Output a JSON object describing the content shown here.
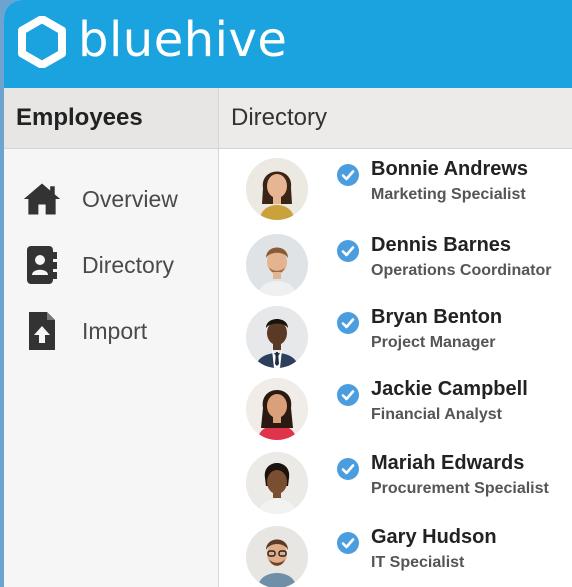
{
  "app": {
    "brand": "bluehive",
    "accent_color": "#1aa3df"
  },
  "sidebar": {
    "title": "Employees",
    "items": [
      {
        "label": "Overview",
        "icon": "home-icon"
      },
      {
        "label": "Directory",
        "icon": "address-book-icon"
      },
      {
        "label": "Import",
        "icon": "file-upload-icon"
      }
    ]
  },
  "main": {
    "title": "Directory",
    "employees": [
      {
        "name": "Bonnie Andrews",
        "role": "Marketing Specialist",
        "verified": true
      },
      {
        "name": "Dennis Barnes",
        "role": "Operations Coordinator",
        "verified": true
      },
      {
        "name": "Bryan Benton",
        "role": "Project Manager",
        "verified": true
      },
      {
        "name": "Jackie Campbell",
        "role": "Financial Analyst",
        "verified": true
      },
      {
        "name": "Mariah Edwards",
        "role": "Procurement Specialist",
        "verified": true
      },
      {
        "name": "Gary Hudson",
        "role": "IT Specialist",
        "verified": true
      }
    ]
  }
}
